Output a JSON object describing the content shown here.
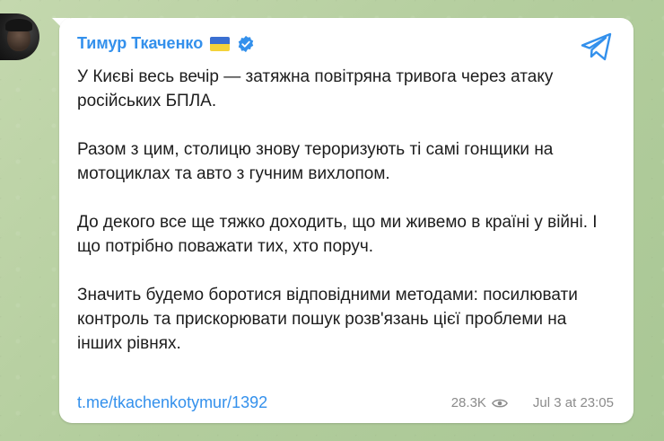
{
  "channel": {
    "sender_name": "Тимур Ткаченко",
    "flag_icon": "ukraine-flag-icon",
    "verified_icon": "verified-badge-icon"
  },
  "message": {
    "paragraphs": [
      "У Києві весь вечір — затяжна повітряна тривога через атаку російських БПЛА.",
      "Разом з цим, столицю знову тероризують ті самі гонщики на мотоциклах та авто з гучним вихлопом.",
      "До декого все ще тяжко доходить, що ми живемо в країні у війні. І що потрібно поважати тих, хто поруч.",
      "Значить будемо боротися відповідними методами: посилювати контроль та прискорювати пошук розв'язань цієї проблеми на інших рівнях."
    ],
    "link": "t.me/tkachenkotymur/1392",
    "views": "28.3K",
    "timestamp": "Jul 3 at 23:05"
  },
  "colors": {
    "accent": "#3390ec",
    "meta_text": "#8b8b8b",
    "background": "#b9d2a4"
  },
  "icons": {
    "share": "telegram-share-icon",
    "views": "eye-icon"
  }
}
